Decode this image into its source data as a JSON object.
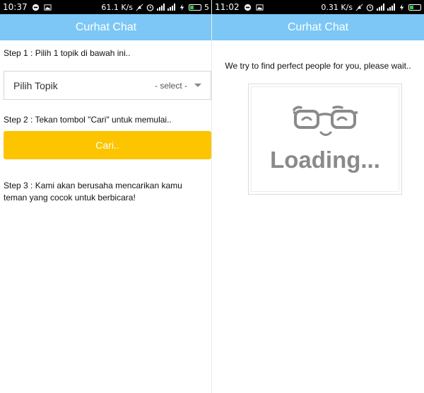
{
  "left": {
    "status": {
      "time": "10:37",
      "speed": "61.1 K/s",
      "battery": "5"
    },
    "app_title": "Curhat Chat",
    "step1": "Step 1 : Pilih 1 topik di bawah ini..",
    "topic_select": {
      "label": "Pilih Topik",
      "value": "- select -"
    },
    "step2": "Step 2 : Tekan tombol \"Cari\" untuk memulai..",
    "search_button": "Cari..",
    "step3": "Step 3 : Kami akan berusaha mencarikan kamu teman yang cocok untuk berbicara!"
  },
  "right": {
    "status": {
      "time": "11:02",
      "speed": "0.31 K/s"
    },
    "app_title": "Curhat Chat",
    "wait_message": "We try to find perfect people for you, please wait..",
    "loading_text": "Loading..."
  },
  "colors": {
    "appbar": "#7cc7f6",
    "button": "#fcc500",
    "loading_gray": "#8a8a8a"
  }
}
